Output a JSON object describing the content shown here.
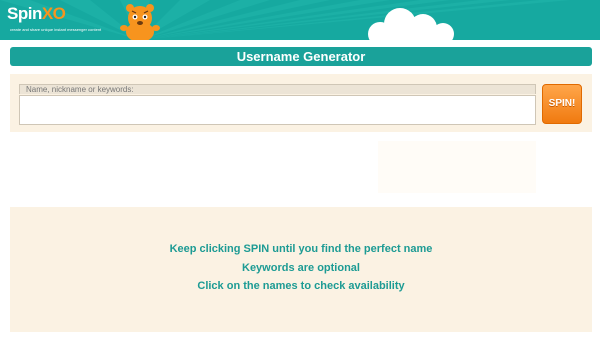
{
  "header": {
    "logo_main": "Spin",
    "logo_accent": "XO",
    "logo_tagline": "create and share unique instant messenger content"
  },
  "generator": {
    "title": "Username Generator",
    "input_label": "Name, nickname or keywords:",
    "input_value": "",
    "spin_label": "SPIN!"
  },
  "info": {
    "lines": [
      "Keep clicking SPIN until you find the perfect name",
      "Keywords are optional",
      "Click on the names to check availability"
    ]
  },
  "colors": {
    "header_teal": "#16a9a0",
    "accent_orange": "#f7941e",
    "panel_cream": "#fbf2e3",
    "info_text": "#1d9b94"
  }
}
